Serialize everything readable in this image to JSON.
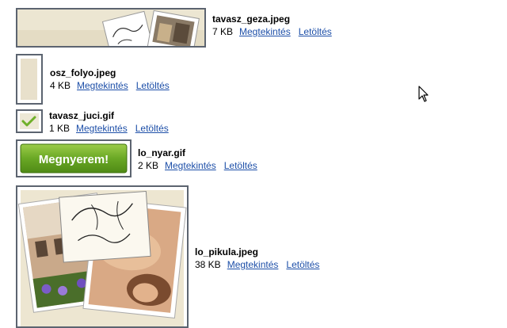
{
  "files": [
    {
      "name": "tavasz_geza.jpeg",
      "size": "7 KB",
      "view_label": "Megtekintés",
      "download_label": "Letöltés"
    },
    {
      "name": "osz_folyo.jpeg",
      "size": "4 KB",
      "view_label": "Megtekintés",
      "download_label": "Letöltés"
    },
    {
      "name": "tavasz_juci.gif",
      "size": "1 KB",
      "view_label": "Megtekintés",
      "download_label": "Letöltés"
    },
    {
      "name": "lo_nyar.gif",
      "size": "2 KB",
      "view_label": "Megtekintés",
      "download_label": "Letöltés",
      "preview_button_text": "Megnyerem!"
    },
    {
      "name": "lo_pikula.jpeg",
      "size": "38 KB",
      "view_label": "Megtekintés",
      "download_label": "Letöltés"
    }
  ],
  "colors": {
    "link": "#1d4fa8",
    "thumb_border": "#5c6470",
    "button_green": "#5e9a1c",
    "parchment": "#ebe3cd"
  },
  "icons": {
    "checkmark": "checkmark-icon",
    "cursor": "mouse-pointer-icon"
  }
}
